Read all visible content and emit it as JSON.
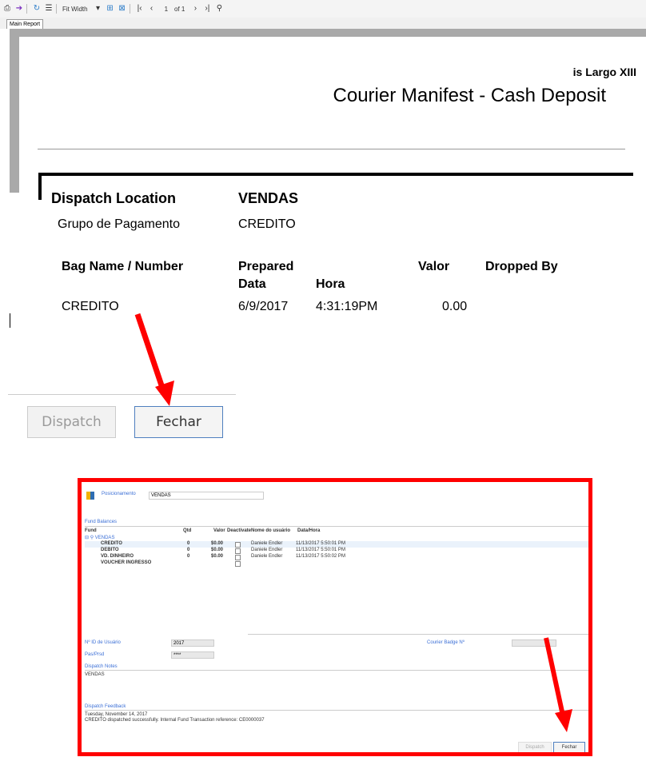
{
  "viewer": {
    "toolbar": {
      "fit": "Fit Width",
      "page_current": "1",
      "page_of": "of 1"
    },
    "tab": "Main Report"
  },
  "report": {
    "company": "is Largo XIII",
    "title": "Courier Manifest - Cash Deposit"
  },
  "details": {
    "dispatch_label": "Dispatch Location",
    "dispatch_value": "VENDAS",
    "group_label": "Grupo de Pagamento",
    "group_value": "CREDITO",
    "col_bag": "Bag Name / Number",
    "col_prepared": "Prepared",
    "col_valor": "Valor",
    "col_dropped": "Dropped By",
    "col_data": "Data",
    "col_hora": "Hora",
    "row_bag": "CREDITO",
    "row_date": "6/9/2017",
    "row_time": "4:31:19PM",
    "row_valor": "0.00"
  },
  "buttons": {
    "dispatch": "Dispatch",
    "close": "Fechar"
  },
  "inset": {
    "posicionamento_label": "Posicionamento",
    "posicionamento_value": "VENDAS",
    "section_fund": "Fund Balances",
    "col_fund": "Fund",
    "col_qtd": "Qtd",
    "col_valor": "Valor",
    "col_deactivate": "Deactivate",
    "col_nome": "Nome do usuário",
    "col_data": "Data/Hora",
    "tree_root": "VENDAS",
    "rows": [
      {
        "name": "CREDITO",
        "qtd": "0",
        "valor": "$0.00",
        "user": "Daniele Endler",
        "date": "11/13/2017 5:50:01 PM"
      },
      {
        "name": "DEBITO",
        "qtd": "0",
        "valor": "$0.00",
        "user": "Daniele Endler",
        "date": "11/13/2017 5:50:01 PM"
      },
      {
        "name": "VD. DINHEIRO",
        "qtd": "0",
        "valor": "$0.00",
        "user": "Daniele Endler",
        "date": "11/13/2017 5:50:02 PM"
      },
      {
        "name": "VOUCHER INGRESSO",
        "qtd": "",
        "valor": "",
        "user": "",
        "date": ""
      }
    ],
    "n_label": "Nº ID de Usuário",
    "n_value": "2017",
    "pw_label": "Pas/Prsd",
    "pw_value": "****",
    "badge_label": "Courier Badge Nº",
    "notes_label": "Dispatch Notes",
    "notes_value": "VENDAS",
    "feedback_label": "Dispatch Feedback",
    "feedback_line1": "Tuesday, November 14, 2017",
    "feedback_line2": "CREDITO dispatched successfully. Internal Fund Transaction reference: CE0000037",
    "btn_dispatch": "Dispatch",
    "btn_close": "Fechar"
  },
  "colors": {
    "highlight_red": "#ff0000",
    "button_border_blue": "#4f7fbf",
    "tree_blue": "#3b6fd6"
  }
}
